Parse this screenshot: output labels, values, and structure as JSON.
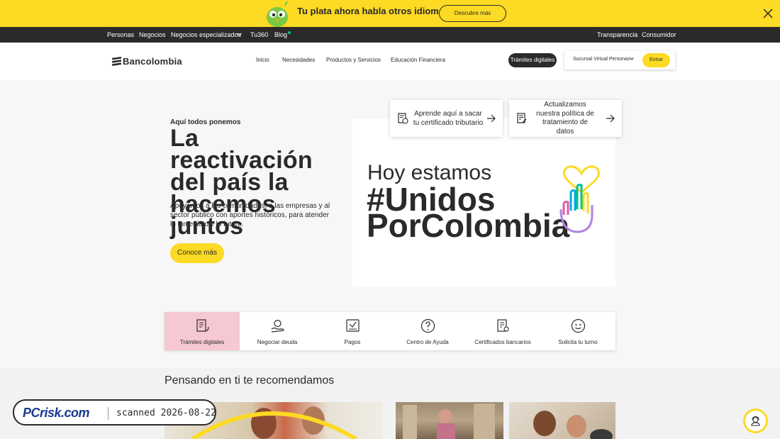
{
  "promo": {
    "text": "Tu plata ahora habla otros idiomas",
    "button": "Descubre más"
  },
  "topnav": {
    "left": [
      "Personas",
      "Negocios",
      "Negocios especializados",
      "Tu360",
      "Blog"
    ],
    "right": [
      "Transparencia",
      "Consumidor"
    ]
  },
  "header": {
    "logo": "Bancolombia",
    "nav": [
      "Inicio",
      "Necesidades",
      "Productos y Servicios",
      "Educación Financiera"
    ],
    "tramites_button": "Trámites digitales",
    "sucursal_label": "Sucursal Virtual Personas",
    "entrar_button": "Entrar"
  },
  "hero": {
    "eyebrow": "Aquí todos ponemos",
    "title": "La reactivación del país la hacemos juntos",
    "description": "Apoyamos a las comunidades, a las empresas y al sector público con aportes históricos, para atender lo inmediato y lo futuro.",
    "cta": "Conoce más"
  },
  "banner": {
    "line1": "Hoy estamos",
    "line2": "#Unidos",
    "line3": "PorColombia"
  },
  "cards": [
    {
      "text": "Aprende aquí a sacar tu certificado tributario",
      "icon": "document-dollar-icon"
    },
    {
      "text": "Actualizamos nuestra política de tratamiento de datos",
      "icon": "document-edit-icon"
    }
  ],
  "quick_actions": [
    {
      "label": "Trámites digitales",
      "icon": "document-hand-icon",
      "active": true
    },
    {
      "label": "Negociar deuda",
      "icon": "hand-coin-icon",
      "active": false
    },
    {
      "label": "Pagos",
      "icon": "payment-icon",
      "active": false
    },
    {
      "label": "Centro de Ayuda",
      "icon": "question-icon",
      "active": false
    },
    {
      "label": "Certificados bancarios",
      "icon": "certificate-icon",
      "active": false
    },
    {
      "label": "Solicita tu turno",
      "icon": "turn-icon",
      "active": false
    }
  ],
  "recommendations": {
    "title": "Pensando en ti te recomendamos"
  },
  "watermark": {
    "logo": "PCrisk.com",
    "scan_text": "scanned 2026-08-22"
  },
  "colors": {
    "brand_yellow": "#fdda24",
    "dark": "#2c2a29",
    "active_pink": "#f5c8d4"
  }
}
